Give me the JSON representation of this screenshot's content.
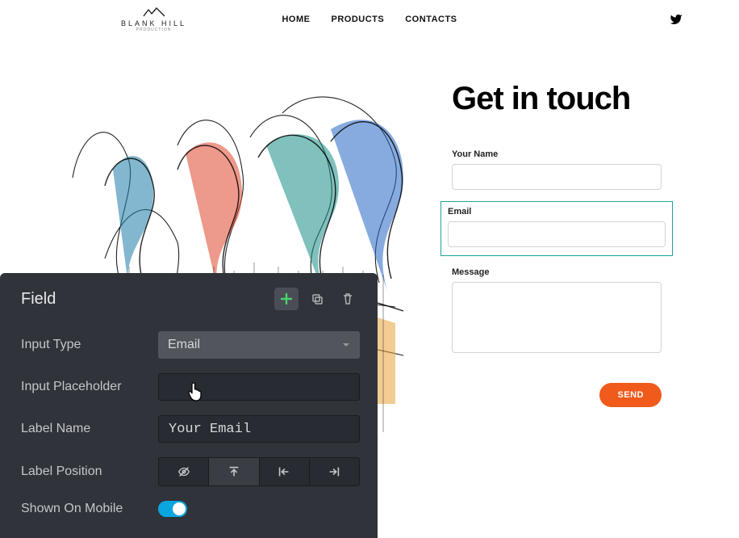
{
  "header": {
    "brand_top": "BLANK HILL",
    "brand_sub": "PRODUCTION",
    "nav": {
      "home": "HOME",
      "products": "PRODUCTS",
      "contacts": "CONTACTS"
    }
  },
  "form": {
    "heading": "Get in touch",
    "name_label": "Your Name",
    "email_label": "Email",
    "message_label": "Message",
    "send_label": "SEND"
  },
  "panel": {
    "title": "Field",
    "rows": {
      "input_type": {
        "label": "Input Type",
        "value": "Email"
      },
      "placeholder": {
        "label": "Input Placeholder",
        "value": ""
      },
      "label_name": {
        "label": "Label Name",
        "value": "Your Email"
      },
      "label_position": {
        "label": "Label Position"
      },
      "shown_mobile": {
        "label": "Shown On Mobile",
        "value": true
      }
    }
  }
}
